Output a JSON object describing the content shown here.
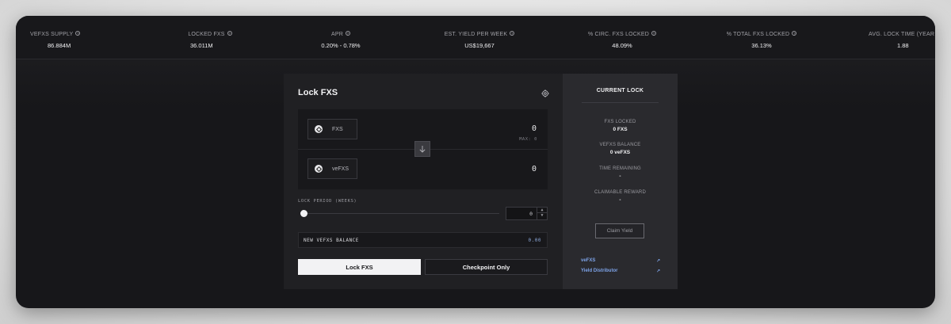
{
  "stats": [
    {
      "label": "VEFXS SUPPLY",
      "value": "86.884M"
    },
    {
      "label": "LOCKED FXS",
      "value": "36.011M"
    },
    {
      "label": "APR",
      "value": "0.20% - 0.78%"
    },
    {
      "label": "EST. YIELD PER WEEK",
      "value": "US$19,667"
    },
    {
      "label": "% CIRC. FXS LOCKED",
      "value": "48.09%"
    },
    {
      "label": "% TOTAL FXS LOCKED",
      "value": "36.13%"
    },
    {
      "label": "AVG. LOCK TIME (YEAR",
      "value": "1.88"
    }
  ],
  "panel": {
    "title": "Lock FXS",
    "icons": {
      "settings": "gear-icon",
      "swap": "arrow-down-icon",
      "token": "frax-logo-icon",
      "info": "info-icon",
      "external": "arrow-up-right-icon"
    },
    "from_token": {
      "symbol": "FXS",
      "amount": "0",
      "max_label": "MAX: 0"
    },
    "to_token": {
      "symbol": "veFXS",
      "amount": "0"
    },
    "lock_period": {
      "label": "LOCK PERIOD (WEEKS)",
      "value": "0",
      "slider_fraction": 0
    },
    "new_balance": {
      "label": "NEW VEFXS BALANCE",
      "value": "0.00"
    },
    "lock_button": "Lock FXS",
    "checkpoint_button": "Checkpoint Only"
  },
  "current_lock": {
    "title": "CURRENT LOCK",
    "rows": [
      {
        "label": "FXS LOCKED",
        "value": "0 FXS"
      },
      {
        "label": "VEFXS BALANCE",
        "value": "0 veFXS"
      },
      {
        "label": "TIME REMAINING",
        "value": "-"
      },
      {
        "label": "CLAIMABLE REWARD",
        "value": "-"
      }
    ],
    "claim_button": "Claim Yield",
    "links": [
      "veFXS",
      "Yield Distributor"
    ]
  },
  "colors": {
    "background": "#17171a",
    "panel": "#202023",
    "side": "#2a2a2e",
    "accent_link": "#7da3e8",
    "balance_value": "#8ba7d8"
  }
}
